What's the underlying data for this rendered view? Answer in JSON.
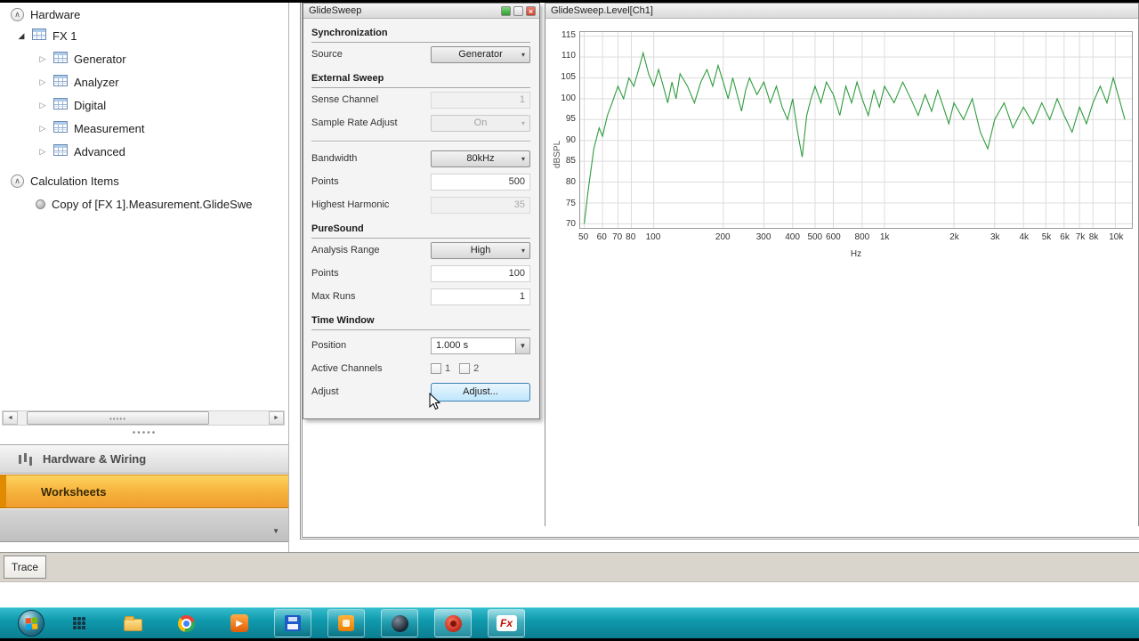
{
  "colors": {
    "accent_orange": "#f6b33d",
    "taskbar_teal": "#109aad",
    "chart_green": "#2e9b3c",
    "hover_button_blue": "#bee6fd"
  },
  "icons": {
    "close": "×",
    "dropdown_arrow": "▾",
    "combo_arrow": "▼",
    "panel_dropdown": "▼",
    "expander_expanded": "◢",
    "expander_collapsed": "▷",
    "collapse_chevron": "∧",
    "scroll_left": "◄",
    "scroll_right": "►",
    "grip_dots": "•••••",
    "play": "▶"
  },
  "tree": {
    "items": [
      {
        "label": "Hardware"
      },
      {
        "label": "FX 1"
      },
      {
        "label": "Generator"
      },
      {
        "label": "Analyzer"
      },
      {
        "label": "Digital"
      },
      {
        "label": "Measurement"
      },
      {
        "label": "Advanced"
      },
      {
        "label": "Calculation Items"
      },
      {
        "label": "Copy of [FX 1].Measurement.GlideSwe"
      }
    ]
  },
  "nav": {
    "hardware_wiring": "Hardware & Wiring",
    "worksheets": "Worksheets"
  },
  "settings": {
    "title": "GlideSweep",
    "sections": {
      "synchronization": "Synchronization",
      "external_sweep": "External Sweep",
      "puresound": "PureSound",
      "time_window": "Time Window"
    },
    "rows": {
      "source": {
        "label": "Source",
        "value": "Generator"
      },
      "sense_channel": {
        "label": "Sense Channel",
        "value": "1"
      },
      "sample_rate_adjust": {
        "label": "Sample Rate Adjust",
        "value": "On"
      },
      "bandwidth": {
        "label": "Bandwidth",
        "value": "80kHz"
      },
      "points": {
        "label": "Points",
        "value": "500"
      },
      "highest_harmonic": {
        "label": "Highest Harmonic",
        "value": "35"
      },
      "analysis_range": {
        "label": "Analysis Range",
        "value": "High"
      },
      "puresound_points": {
        "label": "Points",
        "value": "100"
      },
      "max_runs": {
        "label": "Max Runs",
        "value": "1"
      },
      "position": {
        "label": "Position",
        "value": "1.000 s"
      },
      "active_channels": {
        "label": "Active Channels",
        "ch1_label": "1",
        "ch2_label": "2"
      },
      "adjust": {
        "label": "Adjust",
        "button_label": "Adjust..."
      }
    }
  },
  "chart": {
    "title": "GlideSweep.Level[Ch1]"
  },
  "bottom": {
    "trace_tab": "Trace"
  },
  "taskbar": {
    "fx_label": "Fx"
  },
  "chart_data": {
    "type": "line",
    "title": "GlideSweep.Level[Ch1]",
    "xlabel": "Hz",
    "ylabel": "dBSPL",
    "x_scale": "log",
    "xlim": [
      48,
      11800
    ],
    "ylim": [
      69,
      116
    ],
    "grid": true,
    "legend": "none",
    "y_ticks": [
      70,
      75,
      80,
      85,
      90,
      95,
      100,
      105,
      110,
      115
    ],
    "x_ticks": [
      {
        "v": 50,
        "l": "50"
      },
      {
        "v": 60,
        "l": "60"
      },
      {
        "v": 70,
        "l": "70"
      },
      {
        "v": 80,
        "l": "80"
      },
      {
        "v": 100,
        "l": "100"
      },
      {
        "v": 200,
        "l": "200"
      },
      {
        "v": 300,
        "l": "300"
      },
      {
        "v": 400,
        "l": "400"
      },
      {
        "v": 500,
        "l": "500"
      },
      {
        "v": 600,
        "l": "600"
      },
      {
        "v": 800,
        "l": "800"
      },
      {
        "v": 1000,
        "l": "1k"
      },
      {
        "v": 2000,
        "l": "2k"
      },
      {
        "v": 3000,
        "l": "3k"
      },
      {
        "v": 4000,
        "l": "4k"
      },
      {
        "v": 5000,
        "l": "5k"
      },
      {
        "v": 6000,
        "l": "6k"
      },
      {
        "v": 7000,
        "l": "7k"
      },
      {
        "v": 8000,
        "l": "8k"
      },
      {
        "v": 10000,
        "l": "10k"
      }
    ],
    "series": [
      {
        "name": "Level[Ch1]",
        "color": "#2e9b3c",
        "x": [
          50,
          52,
          55,
          58,
          60,
          63,
          66,
          70,
          74,
          78,
          82,
          86,
          90,
          95,
          100,
          105,
          110,
          115,
          120,
          125,
          130,
          140,
          150,
          160,
          170,
          180,
          190,
          200,
          210,
          220,
          230,
          240,
          250,
          260,
          280,
          300,
          320,
          340,
          360,
          380,
          400,
          420,
          440,
          460,
          480,
          500,
          530,
          560,
          600,
          640,
          680,
          720,
          760,
          800,
          850,
          900,
          950,
          1000,
          1100,
          1200,
          1300,
          1400,
          1500,
          1600,
          1700,
          1800,
          1900,
          2000,
          2200,
          2400,
          2600,
          2800,
          3000,
          3300,
          3600,
          4000,
          4400,
          4800,
          5200,
          5600,
          6000,
          6500,
          7000,
          7500,
          8000,
          8600,
          9200,
          9800,
          10400,
          11000
        ],
        "y": [
          70,
          78,
          88,
          93,
          91,
          96,
          99,
          103,
          100,
          105,
          103,
          107,
          111,
          106,
          103,
          107,
          103,
          99,
          104,
          100,
          106,
          103,
          99,
          104,
          107,
          103,
          108,
          104,
          100,
          105,
          101,
          97,
          102,
          105,
          101,
          104,
          99,
          103,
          98,
          95,
          100,
          92,
          86,
          96,
          100,
          103,
          99,
          104,
          101,
          96,
          103,
          99,
          104,
          100,
          96,
          102,
          98,
          103,
          99,
          104,
          100,
          96,
          101,
          97,
          102,
          98,
          94,
          99,
          95,
          100,
          92,
          88,
          95,
          99,
          93,
          98,
          94,
          99,
          95,
          100,
          96,
          92,
          98,
          94,
          99,
          103,
          99,
          105,
          100,
          95
        ]
      }
    ]
  }
}
